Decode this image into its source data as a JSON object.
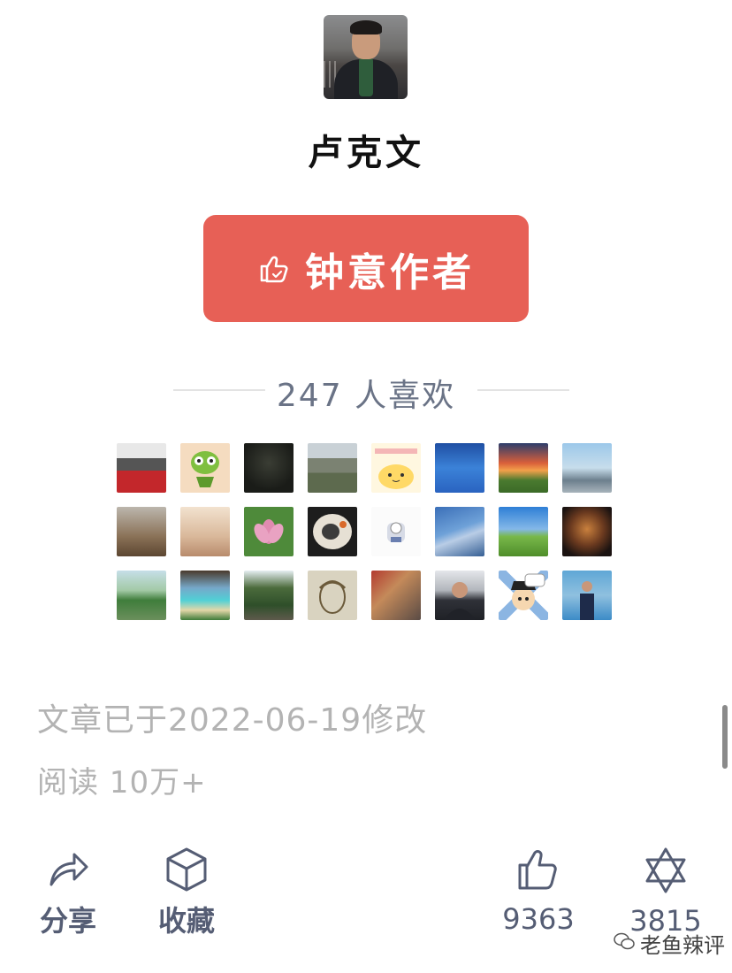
{
  "author": {
    "name": "卢克文"
  },
  "like_button": {
    "label": "钟意作者"
  },
  "likers": {
    "count_label": "247 人喜欢"
  },
  "meta": {
    "modified": "文章已于2022-06-19修改",
    "reads": "阅读 10万+"
  },
  "actions": {
    "share": "分享",
    "favorite": "收藏",
    "like_count": "9363",
    "wow_count": "3815"
  },
  "watermark": "老鱼辣评",
  "colors": {
    "accent": "#e76056",
    "meta_text": "#b3b3b3",
    "icon": "#555d74"
  },
  "icons": [
    "thumb-up-icon",
    "share-icon",
    "cube-icon",
    "star-of-david-icon",
    "wechat-icon"
  ]
}
